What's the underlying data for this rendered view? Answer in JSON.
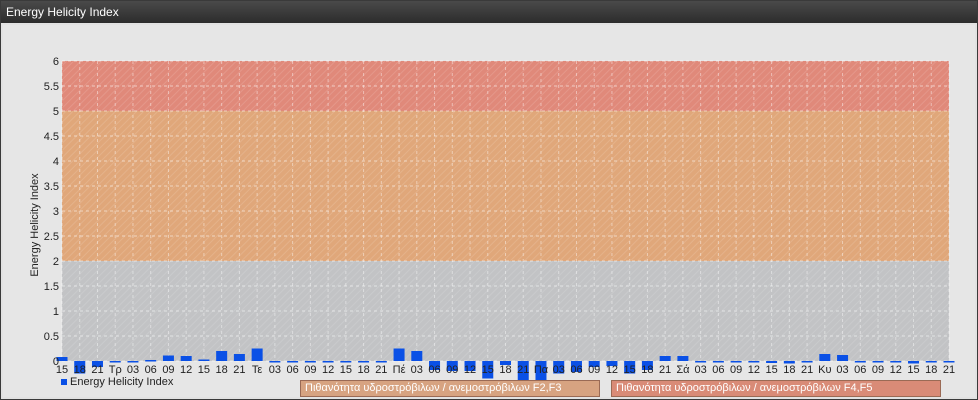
{
  "window": {
    "title": "Energy Helicity Index"
  },
  "legend": {
    "series_label": "Energy Helicity Index",
    "zone_f2f3": "Πιθανότητα υδροστρόβιλων / ανεμοστρόβιλων F2,F3",
    "zone_f4f5": "Πιθανότητα υδροστρόβιλων / ανεμοστρόβιλων F4,F5"
  },
  "chart_data": {
    "type": "bar",
    "ylabel": "Energy Helicity Index",
    "ylim": [
      0,
      6
    ],
    "y_ticks": [
      "0",
      "0.5",
      "1",
      "1.5",
      "2",
      "2.5",
      "3",
      "3.5",
      "4",
      "4.5",
      "5",
      "5.5",
      "6"
    ],
    "zones": [
      {
        "from": 0,
        "to": 2,
        "color": "#c2c3c5"
      },
      {
        "from": 2,
        "to": 5,
        "color": "#e0a77a"
      },
      {
        "from": 5,
        "to": 6,
        "color": "#e0897a"
      }
    ],
    "categories": [
      "15",
      "18",
      "21",
      "Τρ",
      "03",
      "06",
      "09",
      "12",
      "15",
      "18",
      "21",
      "Τε",
      "03",
      "06",
      "09",
      "12",
      "15",
      "18",
      "21",
      "Πέ",
      "03",
      "06",
      "09",
      "12",
      "15",
      "18",
      "21",
      "Πα",
      "03",
      "06",
      "09",
      "12",
      "15",
      "18",
      "21",
      "Σά",
      "03",
      "06",
      "09",
      "12",
      "15",
      "18",
      "21",
      "Κυ",
      "03",
      "06",
      "09",
      "12",
      "15",
      "18",
      "21"
    ],
    "values": [
      0.08,
      -0.25,
      -0.12,
      -0.02,
      -0.02,
      0.02,
      0.11,
      0.1,
      0.03,
      0.2,
      0.14,
      0.25,
      -0.02,
      -0.02,
      -0.02,
      -0.03,
      -0.02,
      -0.02,
      -0.02,
      0.25,
      0.2,
      -0.18,
      -0.2,
      -0.2,
      -0.35,
      -0.08,
      -0.45,
      -0.4,
      -0.25,
      -0.22,
      -0.12,
      -0.1,
      -0.25,
      -0.18,
      0.1,
      0.1,
      -0.02,
      -0.02,
      -0.03,
      -0.03,
      -0.04,
      -0.05,
      -0.03,
      0.14,
      0.12,
      -0.02,
      -0.02,
      -0.02,
      -0.05,
      -0.03,
      -0.03
    ],
    "series_color": "#0a50e6",
    "grid": true
  }
}
